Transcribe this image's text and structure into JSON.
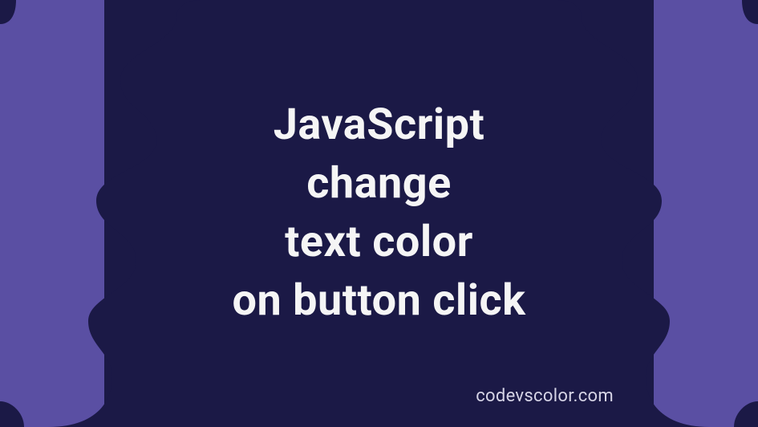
{
  "title": {
    "line1": "JavaScript",
    "line2": "change",
    "line3": "text color",
    "line4": "on button click"
  },
  "watermark": "codevscolor.com",
  "colors": {
    "background": "#5a4fa3",
    "panel": "#1b1946",
    "text": "#f5f5f5",
    "watermark": "#d6d4e6"
  }
}
